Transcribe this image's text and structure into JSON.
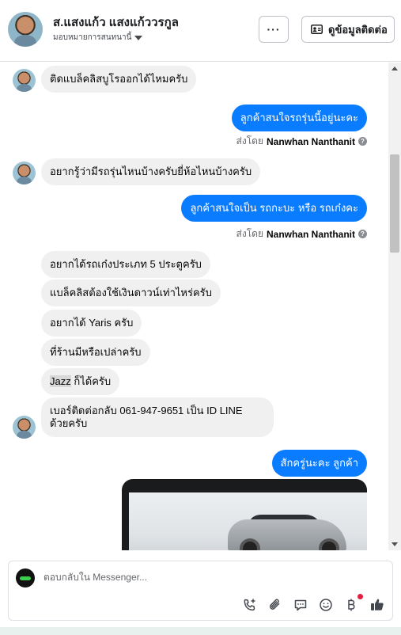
{
  "header": {
    "name": "ส.แสงแก้ว แสงแก้ววรกูล",
    "assign_label": "มอบหมายการสนทนานี้",
    "more_label": "···",
    "contact_button": "ดูข้อมูลติดต่อ"
  },
  "messages": [
    {
      "direction": "in",
      "text": "ติดแบล็คลิสบูโรออกได้ไหมครับ"
    },
    {
      "direction": "out",
      "text": "ลูกค้าสนใจรถรุ่นนี้อยู่นะคะ"
    },
    {
      "direction": "out",
      "text": "ลูกค้าสนใจเป็น รถกะบะ หรือ รถเก๋งคะ"
    },
    {
      "direction": "in",
      "text": "อยากรู้ว่ามีรถรุ่นไหนบ้างครับยี่ห้อไหนบ้างครับ"
    },
    {
      "direction": "in",
      "text": "อยากได้รถเก๋งประเภท 5 ประตูครับ"
    },
    {
      "direction": "in",
      "text": "แบล็คลิสต้องใช้เงินดาวน์เท่าไหร่ครับ"
    },
    {
      "direction": "in",
      "text": "อยากได้ Yaris ครับ"
    },
    {
      "direction": "in",
      "text": "ที่ร้านมีหรือเปล่าครับ"
    },
    {
      "direction": "in",
      "text_highlight": "Jazz",
      "text": " ก็ได้ครับ"
    },
    {
      "direction": "in",
      "text_line1": "เบอร์ติดต่อกลับ 061-947-9651 เป็น ID LINE",
      "text_line2": "ด้วยครับ"
    },
    {
      "direction": "out",
      "text": "สักครู่นะคะ ลูกค้า"
    }
  ],
  "sent_by": {
    "prefix": "ส่งโดย",
    "name": "Nanwhan Nanthanit",
    "info_icon": "?"
  },
  "composer": {
    "placeholder": "ตอบกลับใน Messenger..."
  },
  "icons": {
    "call": "phone-plus-icon",
    "attach": "paperclip-icon",
    "saved_replies": "chat-bubble-icon",
    "emoji": "smiley-icon",
    "payment": "baht-icon",
    "like": "thumbs-up-icon"
  },
  "colors": {
    "outgoing_bubble": "#0a7cff",
    "incoming_bubble": "#f0f0f0",
    "notification_dot": "#e41e3f"
  }
}
